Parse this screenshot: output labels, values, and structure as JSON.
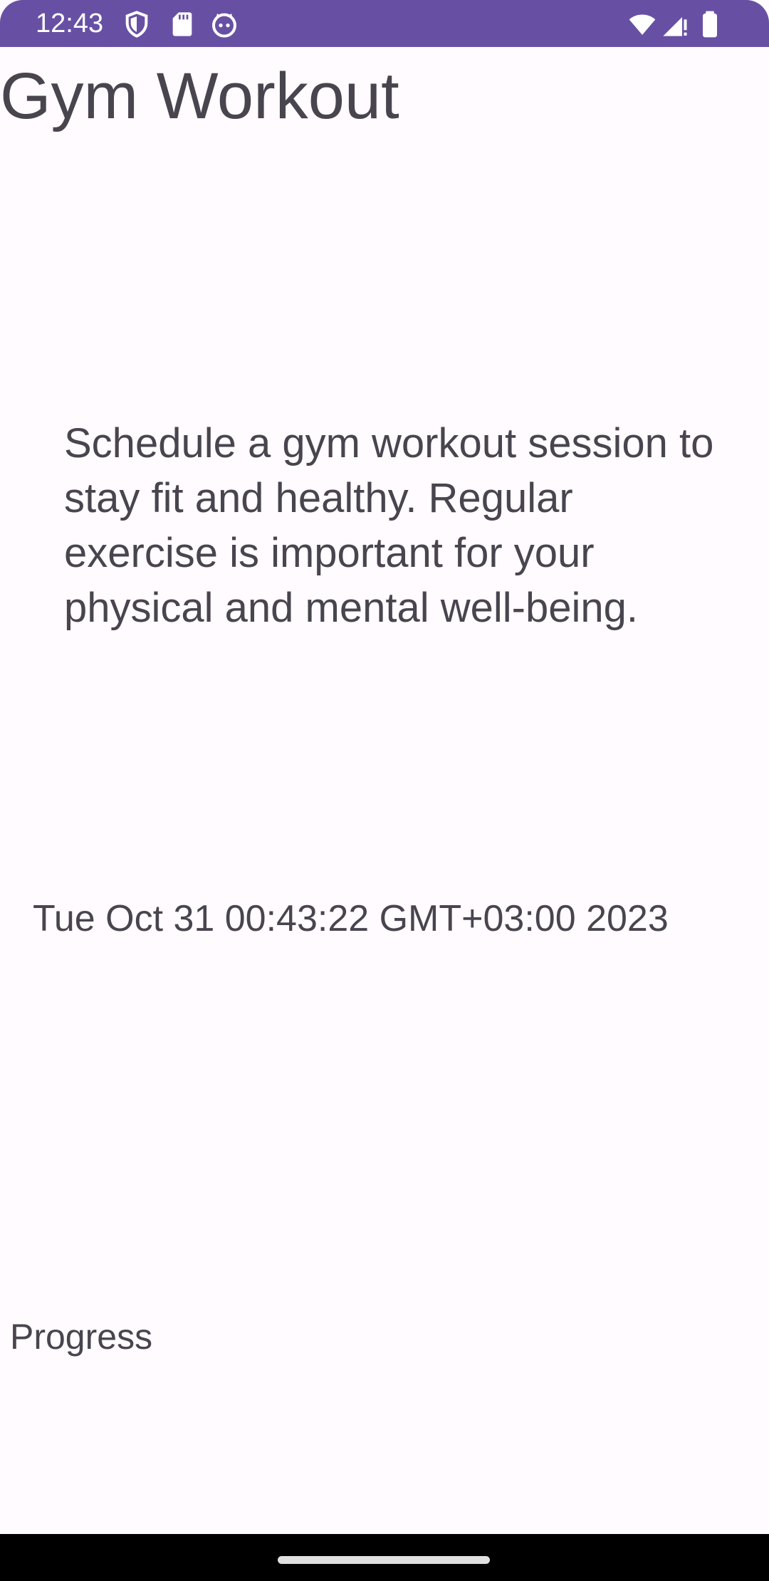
{
  "status_bar": {
    "time": "12:43",
    "background_color": "#6750a4",
    "left_icons": [
      "shield-icon",
      "sd-card-icon",
      "cat-face-icon"
    ],
    "right_icons": [
      "wifi-icon",
      "cellular-signal-icon",
      "battery-icon"
    ]
  },
  "app": {
    "title": "Gym Workout",
    "description": "Schedule a gym workout session to stay fit and healthy. Regular exercise is important for your physical and mental well-being.",
    "datetime": "Tue Oct 31 00:43:22 GMT+03:00 2023",
    "progress_label": "Progress",
    "background_color": "#fffbfe",
    "text_color": "#49454f"
  },
  "nav_bar": {
    "background_color": "#000000",
    "handle": "home-gesture-handle"
  }
}
